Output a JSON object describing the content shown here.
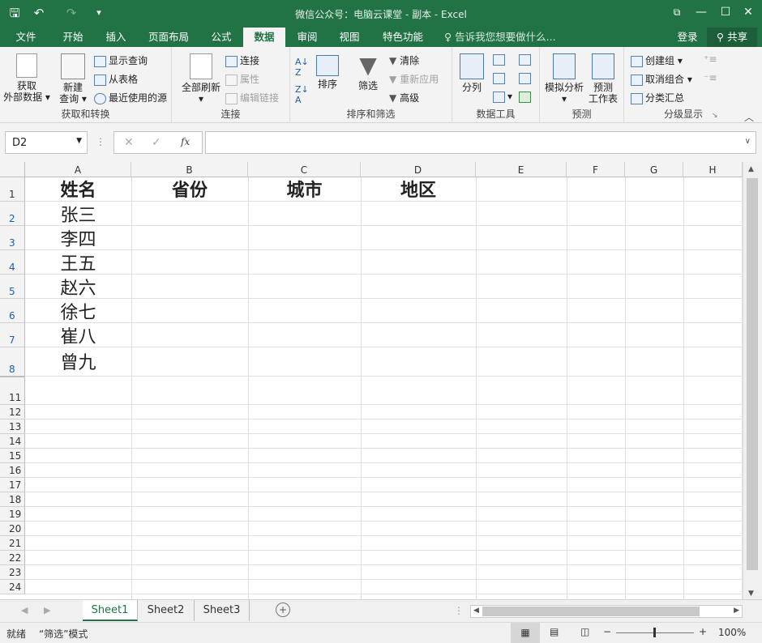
{
  "title": "微信公众号：电脑云课堂 - 副本 - Excel",
  "tabs": [
    "文件",
    "开始",
    "插入",
    "页面布局",
    "公式",
    "数据",
    "审阅",
    "视图",
    "特色功能"
  ],
  "active_tab": "数据",
  "tellme": "告诉我您想要做什么...",
  "login": "登录",
  "share": "共享",
  "ribbon": {
    "get_external": "获取\n外部数据",
    "new_query": "新建\n查询",
    "show_query": "显示查询",
    "from_table": "从表格",
    "recent_sources": "最近使用的源",
    "grp1": "获取和转换",
    "refresh_all": "全部刷新",
    "connections": "连接",
    "properties": "属性",
    "edit_links": "编辑链接",
    "grp2": "连接",
    "sort": "排序",
    "filter": "筛选",
    "clear": "清除",
    "reapply": "重新应用",
    "advanced": "高级",
    "grp3": "排序和筛选",
    "text_to_cols": "分列",
    "grp4": "数据工具",
    "what_if": "模拟分析",
    "forecast_sheet": "预测\n工作表",
    "grp5": "预测",
    "group": "创建组",
    "ungroup": "取消组合",
    "subtotal": "分类汇总",
    "grp6": "分级显示"
  },
  "namebox": "D2",
  "fx": "fx",
  "columns": [
    "A",
    "B",
    "C",
    "D",
    "E",
    "F",
    "G",
    "H"
  ],
  "rows": [
    "1",
    "2",
    "3",
    "4",
    "5",
    "6",
    "7",
    "8",
    "11",
    "12",
    "13",
    "14",
    "15",
    "16",
    "17",
    "18",
    "19",
    "20",
    "21",
    "22",
    "23",
    "24"
  ],
  "headers": [
    "姓名",
    "省份",
    "城市",
    "地区"
  ],
  "names": [
    "张三",
    "李四",
    "王五",
    "赵六",
    "徐七",
    "崔八",
    "曾九"
  ],
  "sheets": [
    "Sheet1",
    "Sheet2",
    "Sheet3"
  ],
  "status": {
    "ready": "就绪",
    "mode": "“筛选”模式",
    "zoom": "100%"
  },
  "colors": {
    "accent": "#217346"
  }
}
